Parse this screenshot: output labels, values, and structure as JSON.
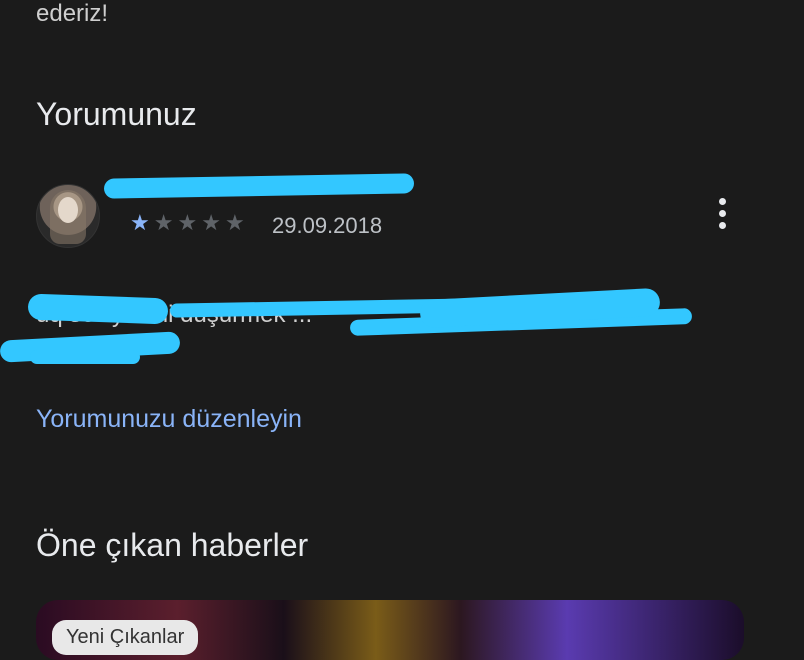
{
  "top_text": "ederiz!",
  "your_review": {
    "title": "Yorumunuz",
    "date": "29.09.2018",
    "rating": 1,
    "max_rating": 5,
    "text_line1": "uq seviyesini düşürmek ...",
    "text_line2": "...",
    "edit_link": "Yorumunuzu düzenleyin"
  },
  "featured_news": {
    "title": "Öne çıkan haberler",
    "card_badge": "Yeni Çıkanlar"
  },
  "colors": {
    "accent": "#8ab4f8",
    "background": "#1b1b1b",
    "redaction": "#33c7ff"
  }
}
